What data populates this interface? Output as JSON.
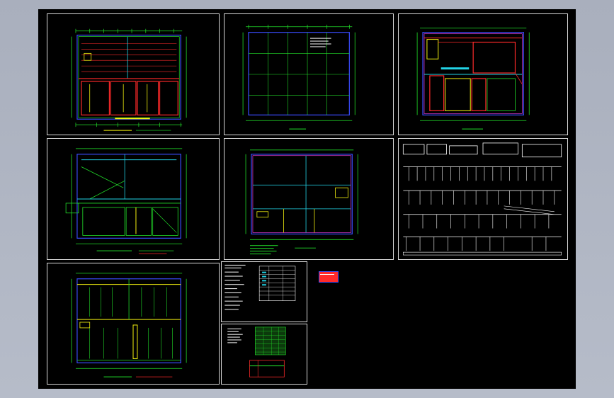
{
  "viewer": {
    "background_color": "#000000",
    "frame_color": "#b0b6c3"
  },
  "sheets": [
    {
      "name": "lighting-plan-1"
    },
    {
      "name": "building-outline-plan"
    },
    {
      "name": "power-plan-1"
    },
    {
      "name": "power-plan-2"
    },
    {
      "name": "grid-plan"
    },
    {
      "name": "distribution-system-diagram"
    },
    {
      "name": "lighting-plan-2"
    },
    {
      "name": "design-notes-legend"
    },
    {
      "name": "detail-table"
    }
  ],
  "colors": {
    "green": "#22e02a",
    "red": "#ff2a2a",
    "yellow": "#f5f20f",
    "cyan": "#22d3e6",
    "blue": "#3a4cff",
    "magenta": "#e53ad8",
    "white": "#ffffff"
  }
}
